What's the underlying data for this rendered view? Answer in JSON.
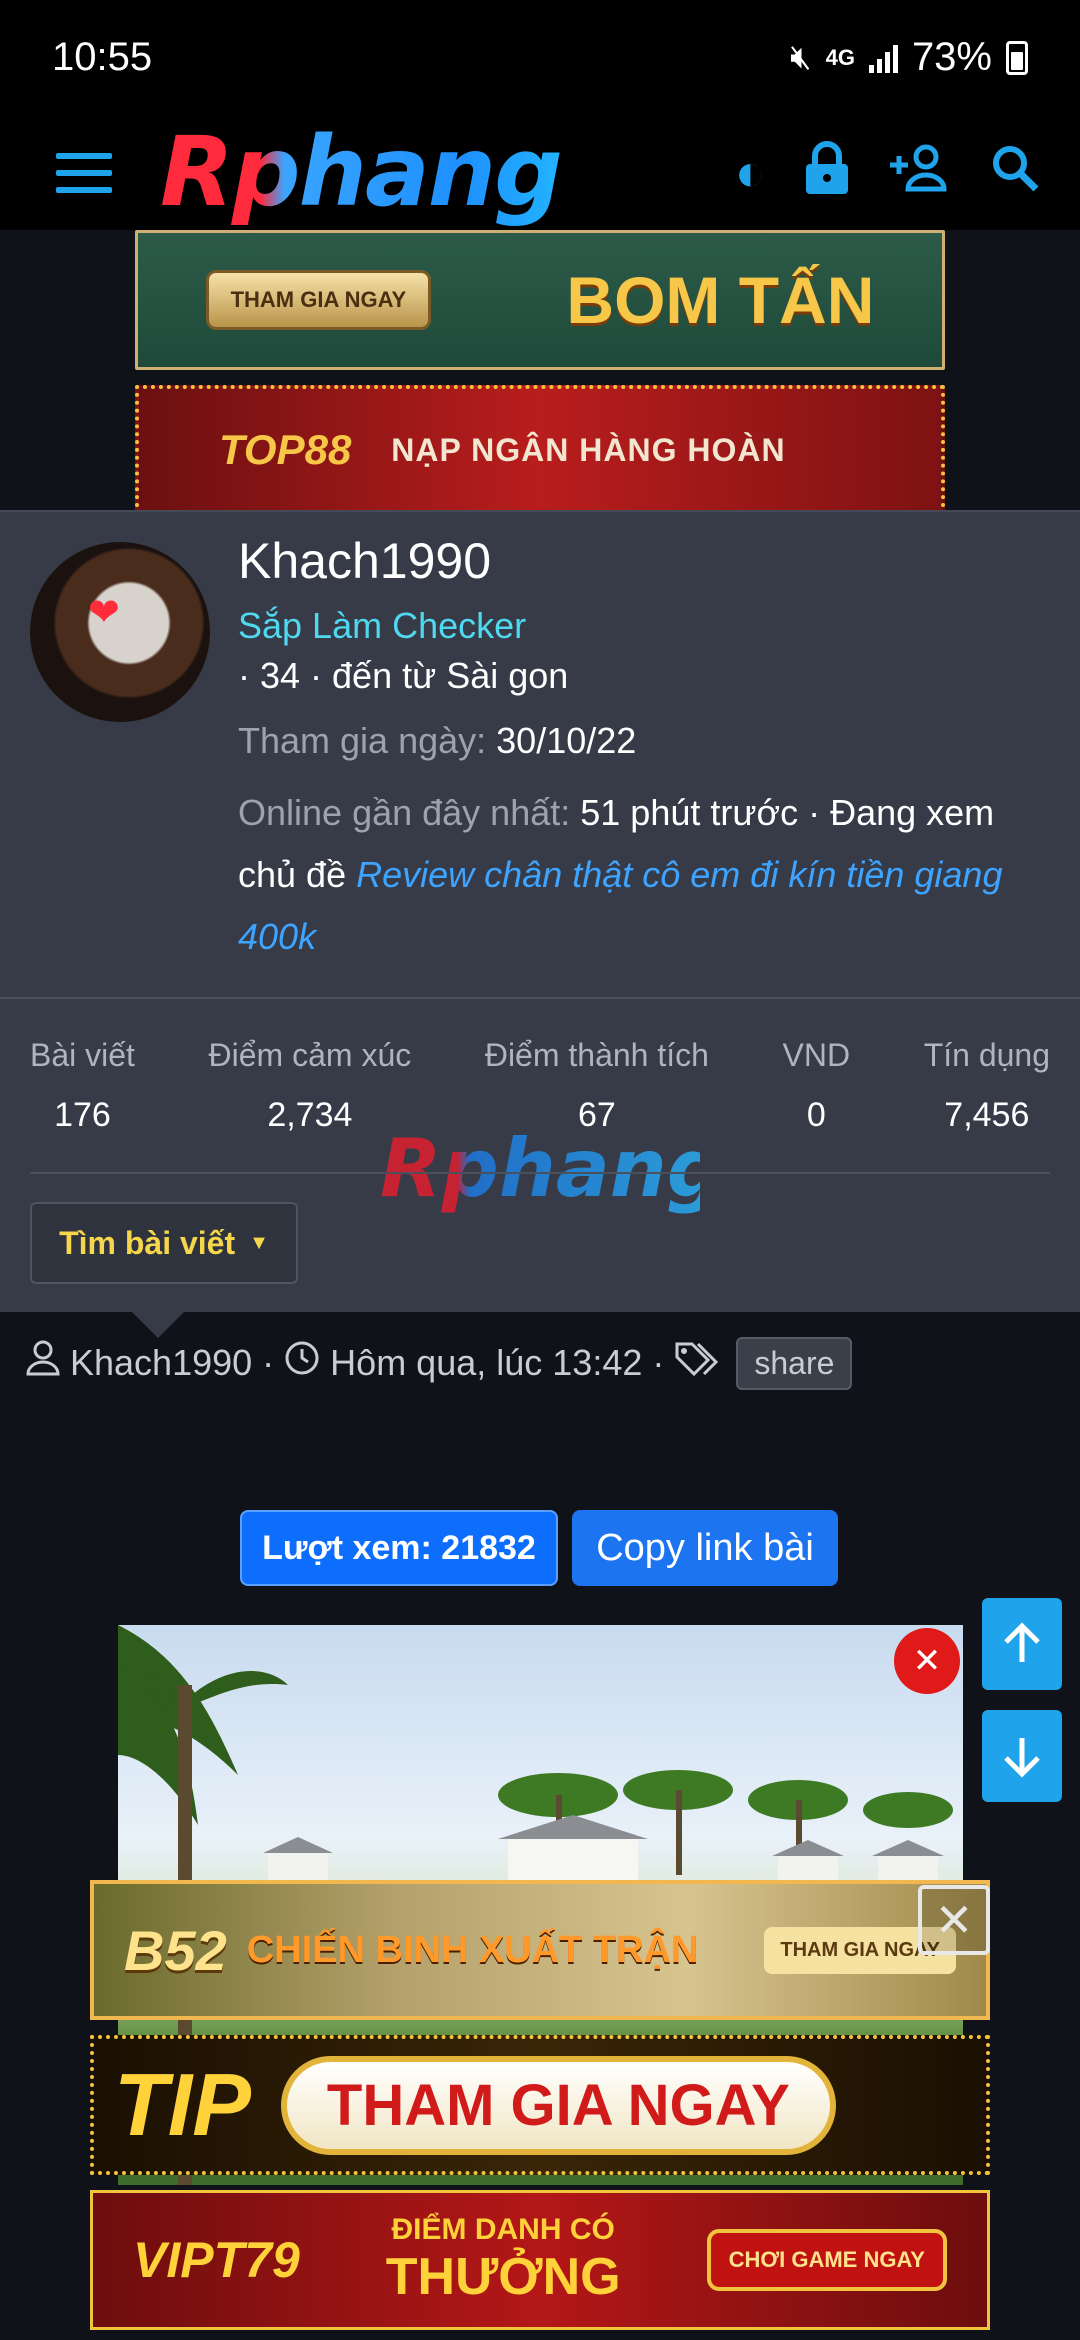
{
  "status_bar": {
    "time": "10:55",
    "network": "4G",
    "battery": "73%"
  },
  "header": {
    "logo": "Rphang",
    "icons": [
      "menu-icon",
      "contrast-icon",
      "lock-icon",
      "add-user-icon",
      "search-icon"
    ]
  },
  "ads_top": {
    "ad1_button": "THAM GIA NGAY",
    "ad1_text": "BOM TẤN",
    "ad2_brand": "TOP88",
    "ad2_text": "NẠP NGÂN HÀNG HOÀN"
  },
  "profile": {
    "username": "Khach1990",
    "user_title": "Sắp Làm Checker",
    "info": "· 34 · đến từ Sài gon",
    "joined_label": "Tham gia ngày:",
    "joined_value": "30/10/22",
    "online_label": "Online gần đây nhất:",
    "online_value": "51 phút trước · Đang xem chủ đề",
    "online_thread": "Review chân thật cô em đi kín tiền giang 400k",
    "stats": [
      {
        "label": "Bài viết",
        "value": "176"
      },
      {
        "label": "Điểm cảm xúc",
        "value": "2,734"
      },
      {
        "label": "Điểm thành tích",
        "value": "67"
      },
      {
        "label": "VND",
        "value": "0"
      },
      {
        "label": "Tín dụng",
        "value": "7,456"
      }
    ],
    "watermark": "Rphang",
    "find_posts_button": "Tìm bài viết"
  },
  "post_meta": {
    "author": "Khach1990",
    "time": "Hôm qua, lúc 13:42",
    "tag": "share"
  },
  "post_actions": {
    "views": "Lượt xem: 21832",
    "copy_link": "Copy link bài"
  },
  "ads_bottom": {
    "b52_brand": "B52",
    "b52_text": "CHIẾN BINH XUẤT TRẬN",
    "b52_button": "THAM GIA NGAY",
    "tip_brand": "TIP",
    "tip_button": "THAM GIA NGAY",
    "vip_brand": "VIPT79",
    "vip_small": "ĐIỂM DANH CÓ",
    "vip_large": "THƯỞNG",
    "vip_button": "CHƠI GAME NGAY"
  }
}
